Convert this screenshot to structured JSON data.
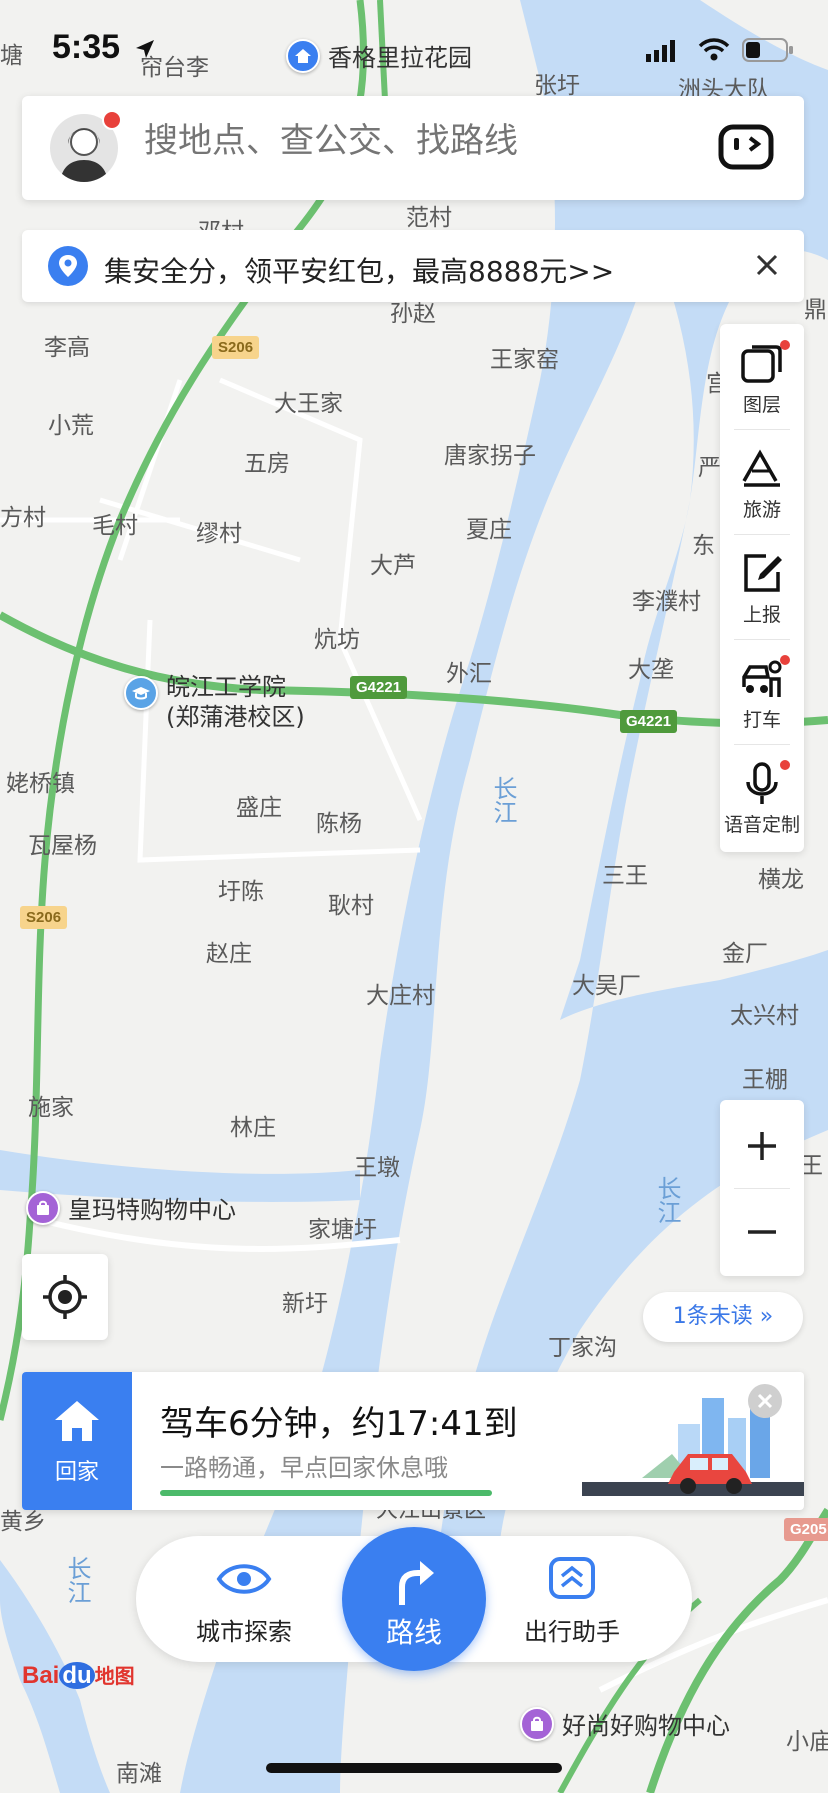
{
  "status_bar": {
    "time": "5:35"
  },
  "search": {
    "placeholder": "搜地点、查公交、找路线"
  },
  "banner": {
    "text": "集安全分，领平安红包，最高8888元>>"
  },
  "toolbar": {
    "items": [
      {
        "label": "图层",
        "icon": "layers-icon",
        "badge": true
      },
      {
        "label": "旅游",
        "icon": "travel-icon",
        "badge": false
      },
      {
        "label": "上报",
        "icon": "report-icon",
        "badge": false
      },
      {
        "label": "打车",
        "icon": "taxi-icon",
        "badge": true
      },
      {
        "label": "语音定制",
        "icon": "microphone-icon",
        "badge": true
      }
    ]
  },
  "unread": {
    "label": "1条未读 »"
  },
  "trip": {
    "home_label": "回家",
    "title": "驾车6分钟，约17:41到",
    "subtitle": "一路畅通，早点回家休息哦",
    "traffic_color": "#4cba6a"
  },
  "bottom_nav": {
    "explore_label": "城市探索",
    "route_label": "路线",
    "assistant_label": "出行助手"
  },
  "logo": {
    "text_bai": "Bai",
    "text_du": "du",
    "text_map": "地图"
  },
  "colors": {
    "accent": "#3a7ff0",
    "river": "#c4dcf6",
    "land": "#f2f2f0",
    "highway": "#6cc070"
  },
  "map": {
    "labels": [
      "帘台李",
      "张圩",
      "洲头大队",
      "范村",
      "孙赵",
      "李高",
      "王家窑",
      "小荒",
      "大王家",
      "五房",
      "唐家拐子",
      "方村",
      "毛村",
      "缪村",
      "夏庄",
      "大芦",
      "李濮村",
      "炕坊",
      "外汇",
      "大垄",
      "姥桥镇",
      "盛庄",
      "陈杨",
      "瓦屋杨",
      "三王",
      "横龙",
      "圩陈",
      "耿村",
      "赵庄",
      "金厂",
      "大庄村",
      "大吴厂",
      "太兴村",
      "施家",
      "王棚",
      "林庄",
      "王墩",
      "家塘圩",
      "新圩",
      "丁家沟",
      "南滩",
      "小庙",
      "塘",
      "邓村",
      "宫",
      "严",
      "东",
      "鼎",
      "黄乡",
      "王"
    ],
    "road_badges": [
      "S206",
      "G4221",
      "G4221",
      "S206",
      "G205"
    ],
    "rivers": [
      "长江",
      "长江",
      "长江"
    ],
    "pois": [
      "香格里拉花园",
      "皖江工学院",
      "(郑蒲港校区)",
      "皇玛特购物中心",
      "好尚好购物中心",
      "大江山景区"
    ]
  }
}
